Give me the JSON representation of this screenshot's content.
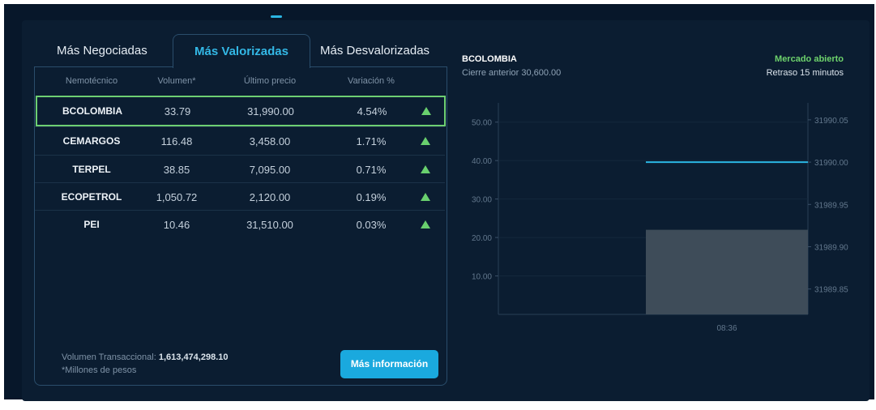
{
  "tabs": [
    {
      "label": "Más Negociadas",
      "active": false
    },
    {
      "label": "Más Valorizadas",
      "active": true
    },
    {
      "label": "Más Desvalorizadas",
      "active": false
    }
  ],
  "table": {
    "headers": [
      "Nemotécnico",
      "Volumen*",
      "Último precio",
      "Variación %"
    ],
    "rows": [
      {
        "name": "BCOLOMBIA",
        "volume": "33.79",
        "price": "31,990.00",
        "change": "4.54%",
        "trend": "up-arrow-icon",
        "selected": true
      },
      {
        "name": "CEMARGOS",
        "volume": "116.48",
        "price": "3,458.00",
        "change": "1.71%",
        "trend": "up-arrow-icon",
        "selected": false
      },
      {
        "name": "TERPEL",
        "volume": "38.85",
        "price": "7,095.00",
        "change": "0.71%",
        "trend": "up-arrow-icon",
        "selected": false
      },
      {
        "name": "ECOPETROL",
        "volume": "1,050.72",
        "price": "2,120.00",
        "change": "0.19%",
        "trend": "up-arrow-icon",
        "selected": false
      },
      {
        "name": "PEI",
        "volume": "10.46",
        "price": "31,510.00",
        "change": "0.03%",
        "trend": "up-arrow-icon",
        "selected": false
      }
    ]
  },
  "footer": {
    "volume_label": "Volumen Transaccional:",
    "volume_value": "1,613,474,298.10",
    "note": "*Millones de pesos",
    "button_label": "Más información"
  },
  "detail": {
    "ticker": "BCOLOMBIA",
    "previous_close": "Cierre anterior 30,600.00",
    "market_status": "Mercado abierto",
    "delay": "Retraso 15 minutos"
  },
  "colors": {
    "accent": "#1aa9de",
    "positive": "#69d06e",
    "background": "#0b1d31",
    "price_line": "#2bb6e3",
    "volume_bar": "#3e4c59"
  },
  "chart_data": {
    "type": "bar",
    "left_axis": {
      "ticks": [
        "50.00",
        "40.00",
        "30.00",
        "20.00",
        "10.00"
      ],
      "range": [
        0,
        55
      ]
    },
    "right_axis": {
      "ticks": [
        "31990.05",
        "31990.00",
        "31989.95",
        "31989.90",
        "31989.85"
      ],
      "range": [
        31989.82,
        31990.07
      ]
    },
    "x_ticks": [
      "08:36"
    ],
    "volume_bar": {
      "x": "08:36",
      "value": 22
    },
    "price_line": {
      "from": "08:36",
      "value": 31990.0
    },
    "grid": true
  }
}
